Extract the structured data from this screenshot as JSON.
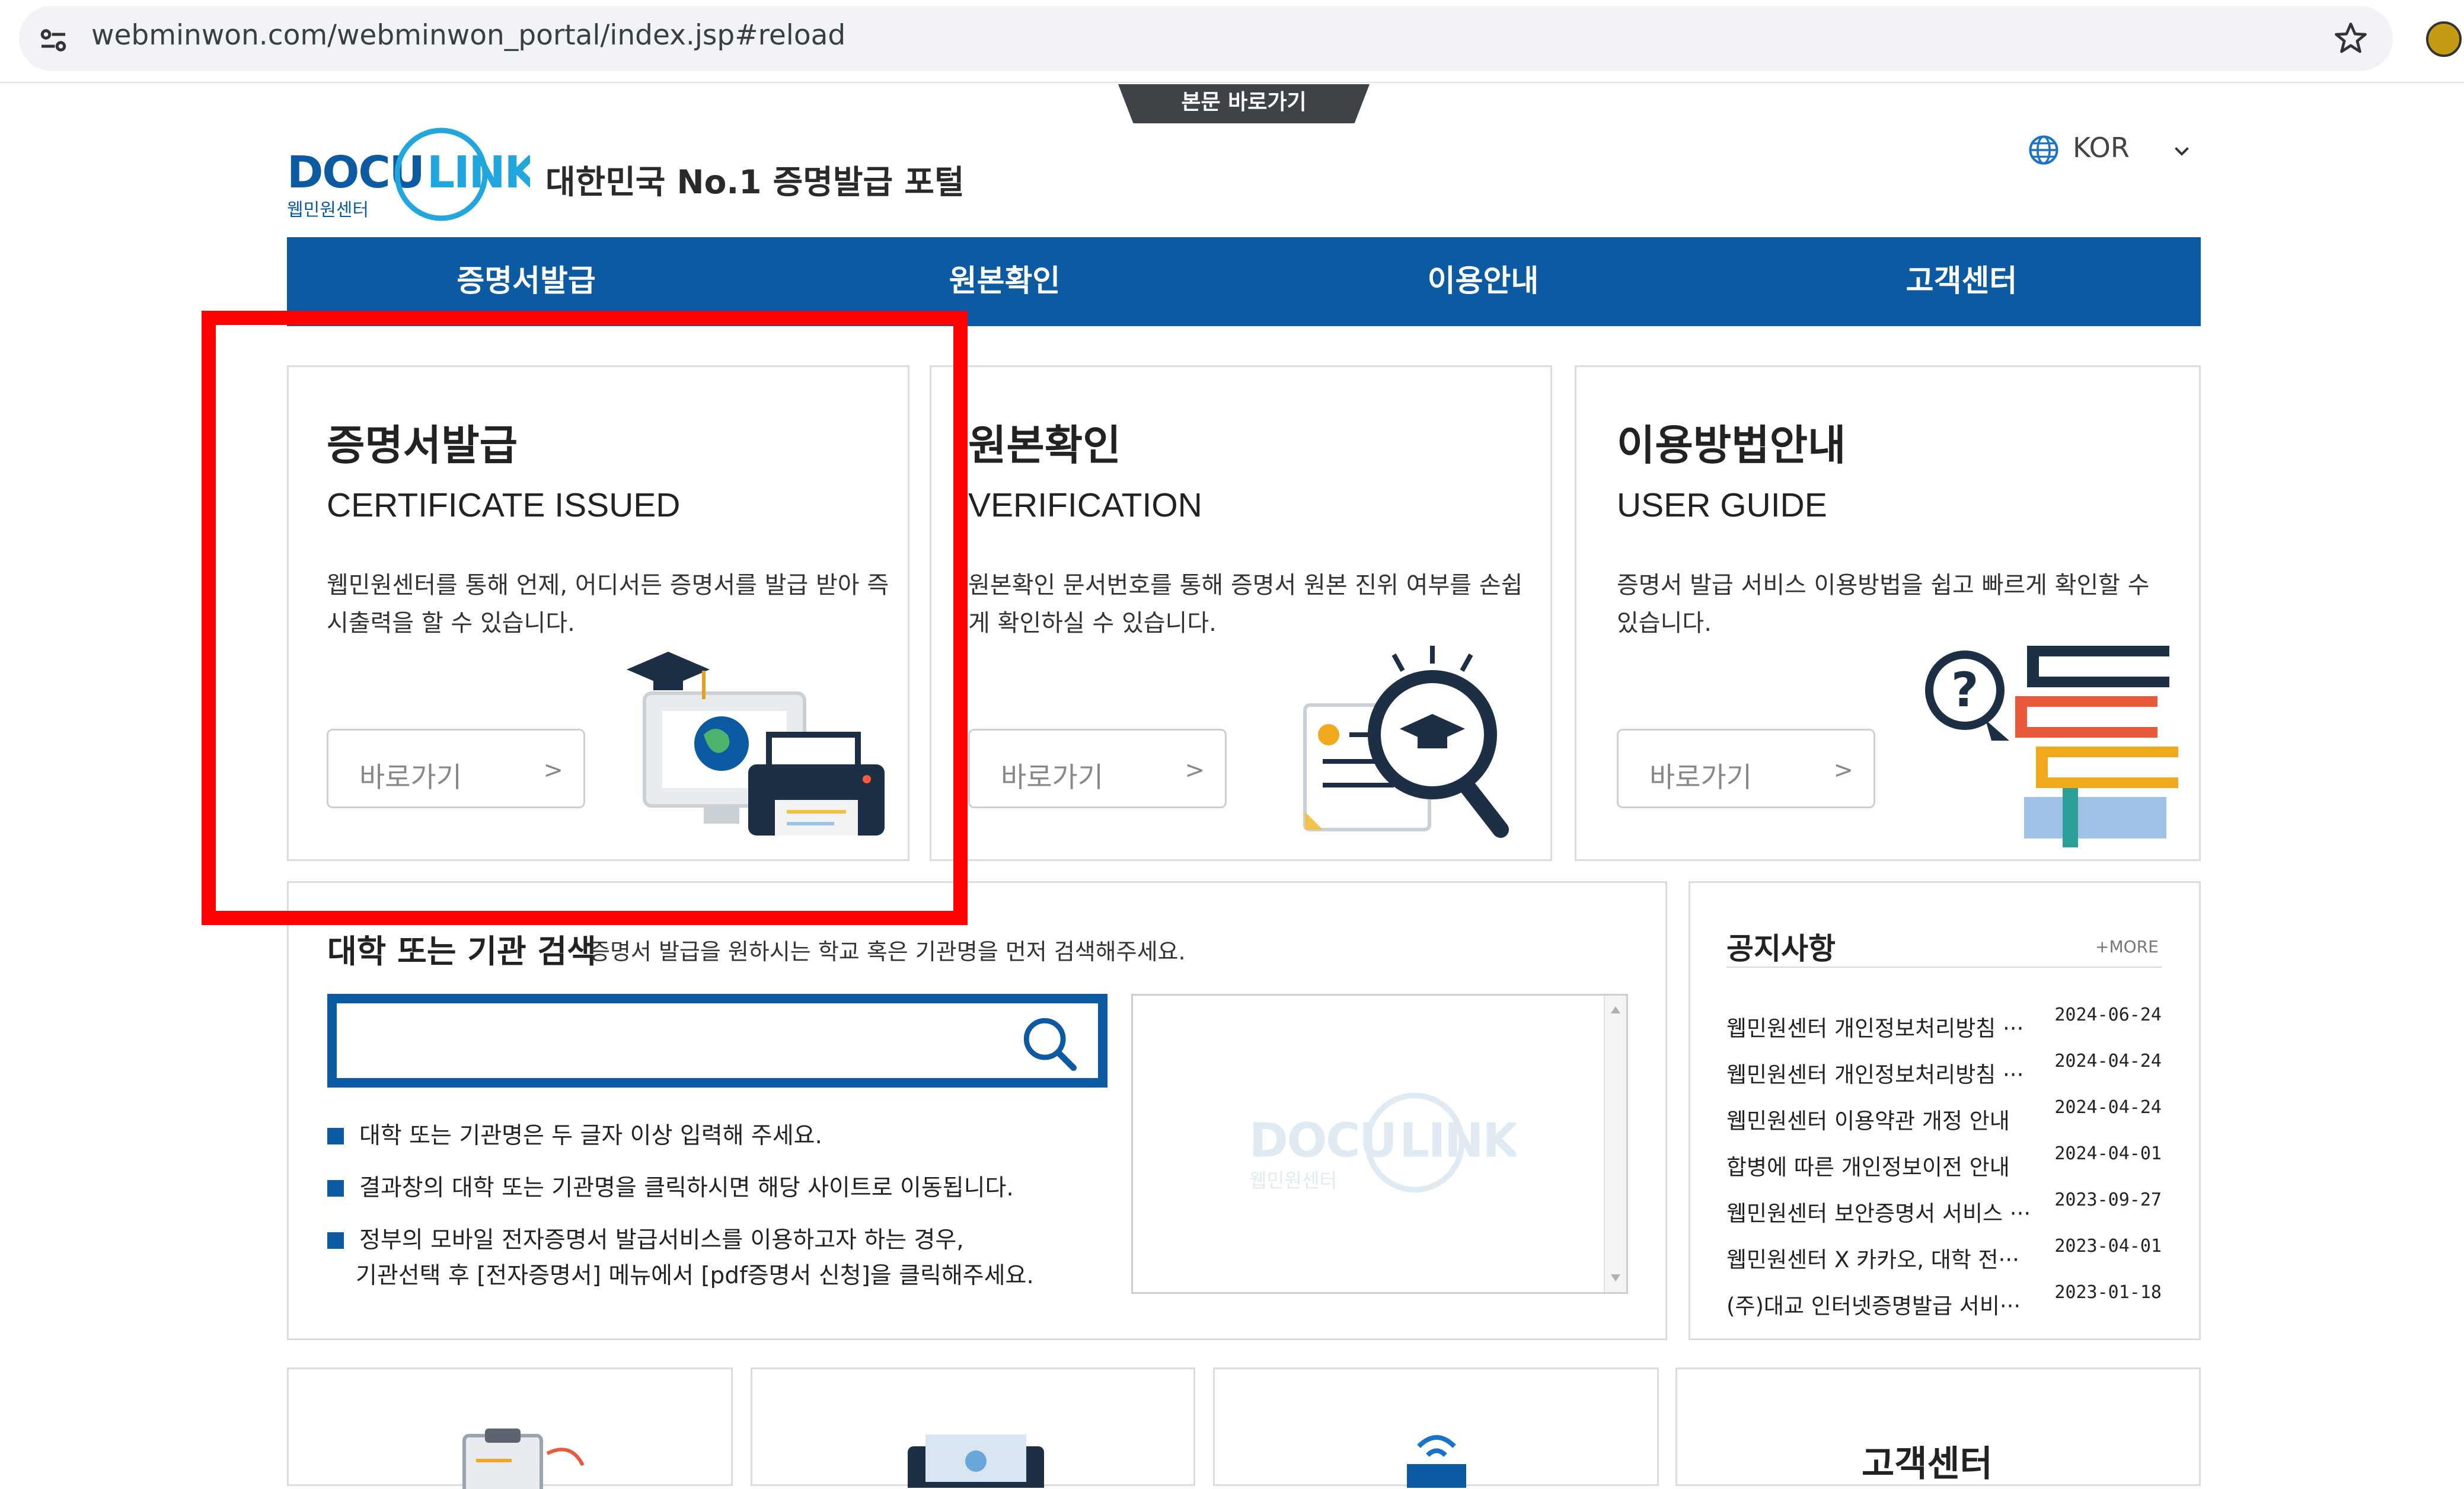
{
  "browser": {
    "url": "webminwon.com/webminwon_portal/index.jsp#reload"
  },
  "skip_link": "본문 바로가기",
  "header": {
    "tagline": "대한민국 No.1 증명발급 포털",
    "logo_text": "DOCU LINK",
    "logo_sub": "웹민원센터",
    "lang": "KOR"
  },
  "nav": {
    "items": [
      {
        "label": "증명서발급"
      },
      {
        "label": "원본확인"
      },
      {
        "label": "이용안내"
      },
      {
        "label": "고객센터"
      }
    ]
  },
  "cards": [
    {
      "title": "증명서발급",
      "subtitle": "CERTIFICATE ISSUED",
      "description": "웹민원센터를 통해 언제, 어디서든 증명서를 발급 받아 즉시출력을 할 수 있습니다.",
      "button": "바로가기",
      "arrow": ">",
      "icon": "computer-printer-icon"
    },
    {
      "title": "원본확인",
      "subtitle": "VERIFICATION",
      "description": "원본확인 문서번호를 통해 증명서 원본 진위 여부를 손쉽게 확인하실 수 있습니다.",
      "button": "바로가기",
      "arrow": ">",
      "icon": "magnifier-certificate-icon"
    },
    {
      "title": "이용방법안내",
      "subtitle": "USER GUIDE",
      "description": "증명서 발급 서비스 이용방법을 쉽고 빠르게 확인할 수 있습니다.",
      "button": "바로가기",
      "arrow": ">",
      "icon": "question-books-icon"
    }
  ],
  "search": {
    "title": "대학 또는 기관 검색",
    "hint": "증명서 발급을 원하시는 학교 혹은 기관명을 먼저 검색해주세요.",
    "placeholder": "",
    "tips": [
      "대학 또는 기관명은 두 글자 이상 입력해 주세요.",
      "결과창의 대학 또는 기관명을 클릭하시면 해당 사이트로 이동됩니다.",
      "정부의 모바일 전자증명서 발급서비스를 이용하고자 하는 경우,"
    ],
    "tip3_cont": "기관선택 후 [전자증명서] 메뉴에서 [pdf증명서 신청]을 클릭해주세요."
  },
  "notice": {
    "title": "공지사항",
    "more": "+MORE",
    "items": [
      {
        "text": "웹민원센터 개인정보처리방침 ···",
        "date": "2024-06-24"
      },
      {
        "text": "웹민원센터 개인정보처리방침 ···",
        "date": "2024-04-24"
      },
      {
        "text": "웹민원센터 이용약관 개정 안내",
        "date": "2024-04-24"
      },
      {
        "text": "합병에 따른 개인정보이전 안내",
        "date": "2024-04-01"
      },
      {
        "text": "웹민원센터 보안증명서 서비스 ···",
        "date": "2023-09-27"
      },
      {
        "text": "웹민원센터 X 카카오, 대학 전···",
        "date": "2023-04-01"
      },
      {
        "text": "(주)대교 인터넷증명발급 서비···",
        "date": "2023-01-18"
      }
    ]
  },
  "bottom": {
    "customer_center": "고객센터"
  },
  "colors": {
    "nav_blue": "#0c5aa1",
    "highlight_red": "#ff0000",
    "logo_blue": "#0c5aa1",
    "logo_cyan": "#21a6dd"
  }
}
